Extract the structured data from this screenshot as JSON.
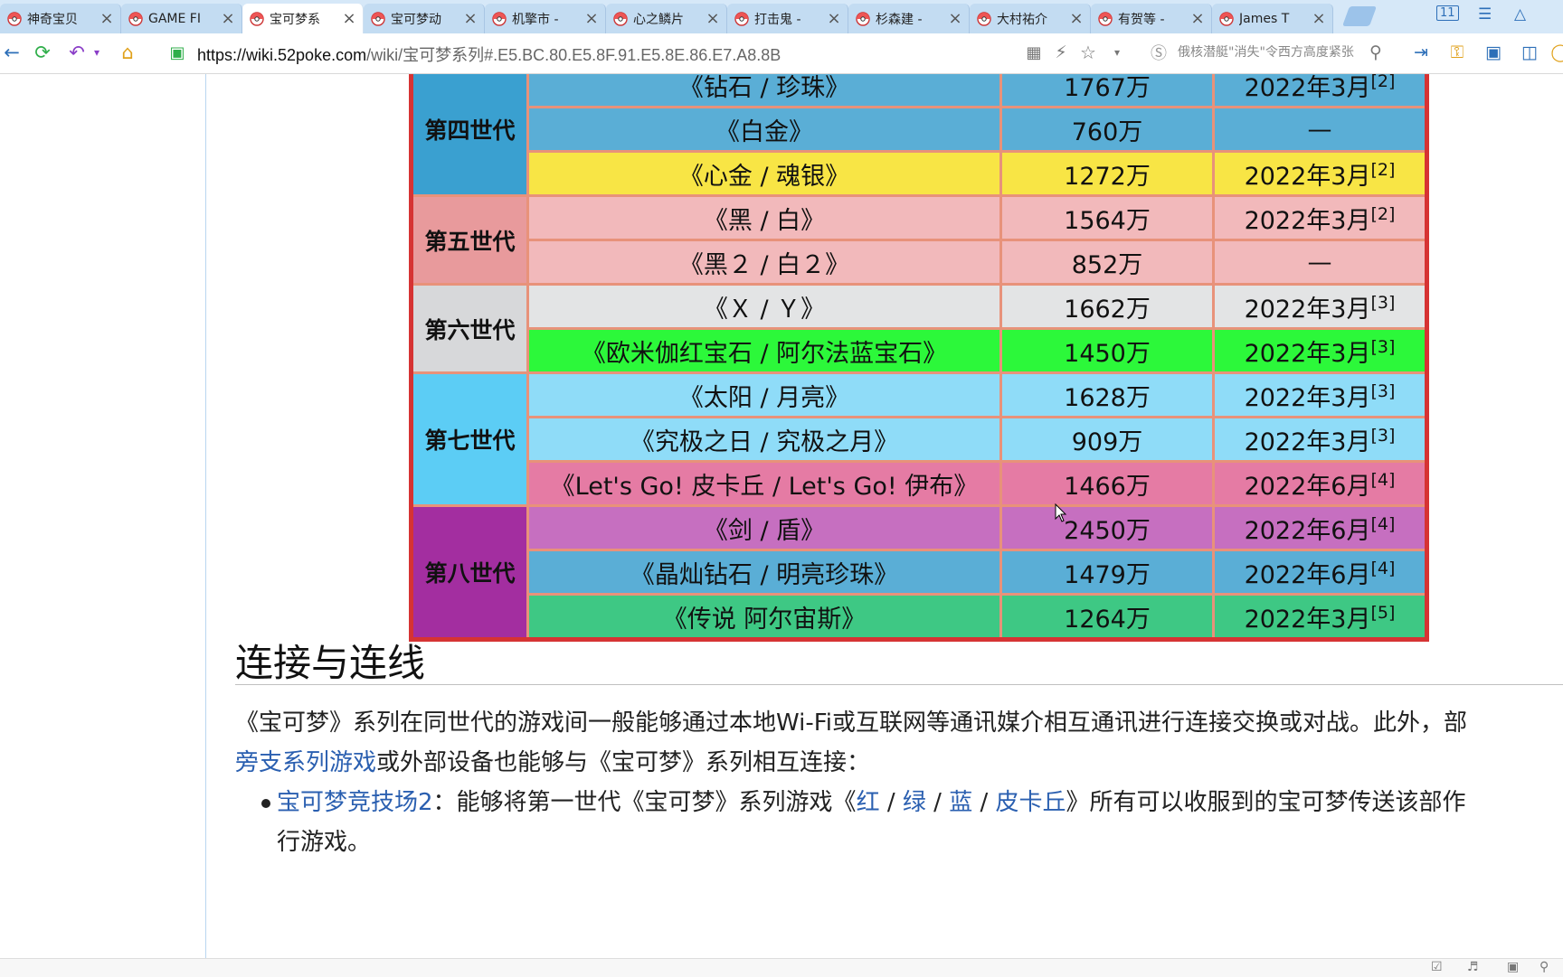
{
  "tabs": [
    {
      "label": "神奇宝贝",
      "active": false
    },
    {
      "label": "GAME FI",
      "active": false
    },
    {
      "label": "宝可梦系",
      "active": true
    },
    {
      "label": "宝可梦动",
      "active": false
    },
    {
      "label": "机擎市 -",
      "active": false
    },
    {
      "label": "心之鳞片",
      "active": false
    },
    {
      "label": "打击鬼 -",
      "active": false
    },
    {
      "label": "杉森建 -",
      "active": false
    },
    {
      "label": "大村祐介",
      "active": false
    },
    {
      "label": "有贺等 -",
      "active": false
    },
    {
      "label": "James T",
      "active": false
    }
  ],
  "window": {
    "tab_count_badge": "11"
  },
  "address": {
    "url_host": "https://wiki.52poke.com",
    "url_path": "/wiki/宝可梦系列#.E5.BC.80.E5.8F.91.E5.8E.86.E7.A8.8B",
    "search_placeholder": "俄核潜艇\"消失\"令西方高度紧张"
  },
  "table": {
    "rows": [
      {
        "gen": "第四世代",
        "title": "《钻石 / 珍珠》",
        "sales": "1767万",
        "date": "2022年3月",
        "ref": "[2]",
        "bg": "#5aaed6",
        "gen_bg": "#3aa0d0"
      },
      {
        "gen": "",
        "title": "《白金》",
        "sales": "760万",
        "date": "—",
        "ref": "",
        "bg": "#5aaed6"
      },
      {
        "gen": "",
        "title": "《心金 / 魂银》",
        "sales": "1272万",
        "date": "2022年3月",
        "ref": "[2]",
        "bg": "#f8e545"
      },
      {
        "gen": "第五世代",
        "title": "《黑 / 白》",
        "sales": "1564万",
        "date": "2022年3月",
        "ref": "[2]",
        "bg": "#f2b9bb",
        "gen_bg": "#e89a9c"
      },
      {
        "gen": "",
        "title": "《黑２ / 白２》",
        "sales": "852万",
        "date": "—",
        "ref": "",
        "bg": "#f2b9bb"
      },
      {
        "gen": "第六世代",
        "title": "《Ｘ / Ｙ》",
        "sales": "1662万",
        "date": "2022年3月",
        "ref": "[3]",
        "bg": "#e3e4e5",
        "gen_bg": "#d7d8da"
      },
      {
        "gen": "",
        "title": "《欧米伽红宝石 / 阿尔法蓝宝石》",
        "sales": "1450万",
        "date": "2022年3月",
        "ref": "[3]",
        "bg": "#2cf83a"
      },
      {
        "gen": "第七世代",
        "title": "《太阳 / 月亮》",
        "sales": "1628万",
        "date": "2022年3月",
        "ref": "[3]",
        "bg": "#8fdcf8",
        "gen_bg": "#5ccdf5"
      },
      {
        "gen": "",
        "title": "《究极之日 / 究极之月》",
        "sales": "909万",
        "date": "2022年3月",
        "ref": "[3]",
        "bg": "#8fdcf8"
      },
      {
        "gen": "",
        "title": "《Let's Go! 皮卡丘 / Let's Go! 伊布》",
        "sales": "1466万",
        "date": "2022年6月",
        "ref": "[4]",
        "bg": "#e57ba4"
      },
      {
        "gen": "第八世代",
        "title": "《剑 / 盾》",
        "sales": "2450万",
        "date": "2022年6月",
        "ref": "[4]",
        "bg": "#c66fc0",
        "gen_bg": "#a32ea0"
      },
      {
        "gen": "",
        "title": "《晶灿钻石 / 明亮珍珠》",
        "sales": "1479万",
        "date": "2022年6月",
        "ref": "[4]",
        "bg": "#5aaed6"
      },
      {
        "gen": "",
        "title": "《传说 阿尔宙斯》",
        "sales": "1264万",
        "date": "2022年3月",
        "ref": "[5]",
        "bg": "#3ec884"
      }
    ]
  },
  "section": {
    "heading": "连接与连线",
    "para_line1": "《宝可梦》系列在同世代的游戏间一般能够通过本地Wi-Fi或互联网等通讯媒介相互通讯进行连接交换或对战。此外，部",
    "para_link": "旁支系列游戏",
    "para_line2_rest": "或外部设备也能够与《宝可梦》系列相互连接：",
    "bullet_link": "宝可梦竞技场2",
    "bullet_text1": "：能够将第一世代《宝可梦》系列游戏《",
    "bullet_link_red": "红",
    "bullet_sep": " / ",
    "bullet_link_green": "绿",
    "bullet_link_blue": "蓝",
    "bullet_link_pika": "皮卡丘",
    "bullet_text2": "》所有可以收服到的宝可梦传送该部作",
    "bullet_line2": "行游戏。"
  }
}
